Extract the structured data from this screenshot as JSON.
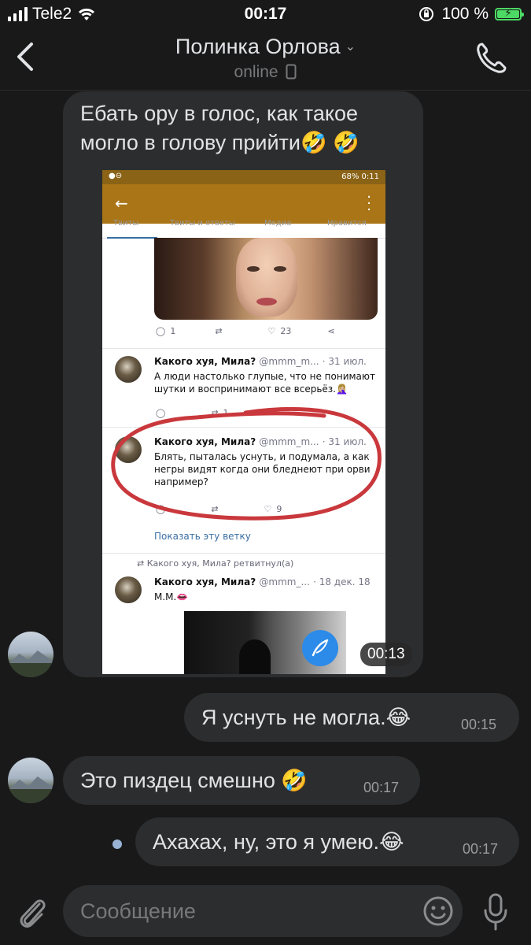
{
  "status_bar": {
    "carrier": "Tele2",
    "time": "00:17",
    "battery_percent": "100 %"
  },
  "header": {
    "contact_name": "Полинка Орлова",
    "status": "online"
  },
  "messages": [
    {
      "id": "m1",
      "direction": "incoming",
      "text": "Ебать ору в голос, как такое могло в голову прийти🤣 🤣",
      "attachment_duration": "00:13"
    },
    {
      "id": "m2",
      "direction": "outgoing",
      "text": "Я уснуть не могла.😂",
      "time": "00:15"
    },
    {
      "id": "m3",
      "direction": "incoming",
      "text": "Это пиздец смешно 🤣",
      "time": "00:17"
    },
    {
      "id": "m4",
      "direction": "outgoing",
      "text": "Ахахах, ну, это я умею.😂",
      "time": "00:17",
      "unread": true
    }
  ],
  "screenshot": {
    "status": "68% 0:11",
    "tabs": [
      "Твиты",
      "Твиты и ответы",
      "Медиа",
      "Нравится"
    ],
    "tweet_top": {
      "replies": "1",
      "likes": "23"
    },
    "tweets": [
      {
        "author": "Какого хуя, Мила?",
        "handle": "@mmm_m...",
        "date": "· 31 июл.",
        "text": "А люди настолько глупые, что не понимают шутки и воспринимают все всерьёз.🤦🏼‍♀️",
        "replies": "",
        "retweets": "1"
      },
      {
        "author": "Какого хуя, Мила?",
        "handle": "@mmm_m...",
        "date": "· 31 июл.",
        "text": "Блять, пыталась уснуть, и подумала, а как негры видят когда они бледнеют при орви например?",
        "replies": "",
        "likes": "9"
      }
    ],
    "show_thread": "Показать эту ветку",
    "retweet_label": "Какого хуя, Мила? ретвитнул(а)",
    "tweet3": {
      "author": "Какого хуя, Мила?",
      "handle": "@mmm_...",
      "date": "· 18 дек. 18",
      "text": "М.М.👄"
    }
  },
  "input": {
    "placeholder": "Сообщение"
  },
  "colors": {
    "background": "#19191a",
    "bubble": "#2c2d2e",
    "text": "#e1e3e6",
    "secondary": "#76787a",
    "highlight_circle": "#c9383c",
    "fab": "#2c8ae8"
  }
}
